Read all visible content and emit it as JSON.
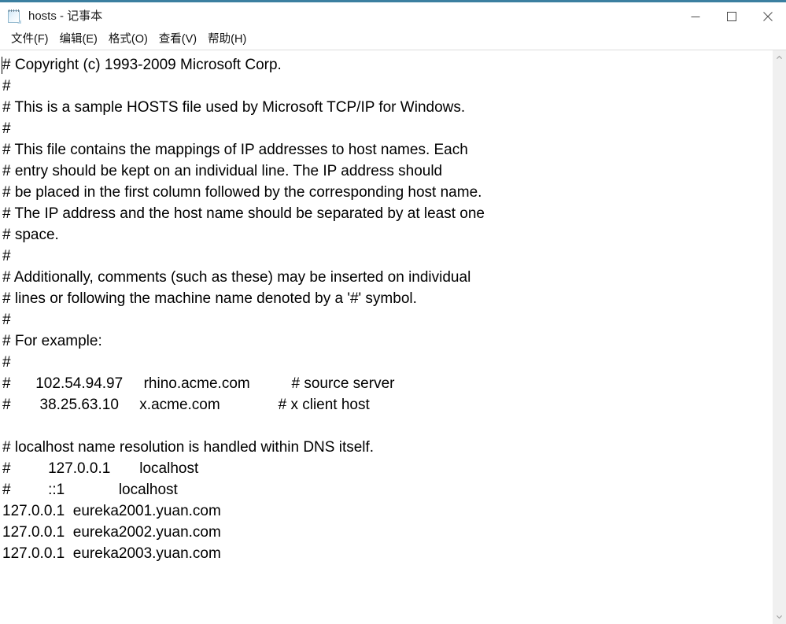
{
  "window": {
    "title": "hosts - 记事本",
    "icon": "notepad-icon",
    "accent_color": "#3b7fa0",
    "controls": {
      "minimize_label": "最小化",
      "maximize_label": "最大化",
      "close_label": "关闭"
    }
  },
  "menubar": {
    "items": [
      {
        "label": "文件(F)"
      },
      {
        "label": "编辑(E)"
      },
      {
        "label": "格式(O)"
      },
      {
        "label": "查看(V)"
      },
      {
        "label": "帮助(H)"
      }
    ]
  },
  "editor": {
    "caret_visible": true,
    "lines": [
      "# Copyright (c) 1993-2009 Microsoft Corp.",
      "#",
      "# This is a sample HOSTS file used by Microsoft TCP/IP for Windows.",
      "#",
      "# This file contains the mappings of IP addresses to host names. Each",
      "# entry should be kept on an individual line. The IP address should",
      "# be placed in the first column followed by the corresponding host name.",
      "# The IP address and the host name should be separated by at least one",
      "# space.",
      "#",
      "# Additionally, comments (such as these) may be inserted on individual",
      "# lines or following the machine name denoted by a '#' symbol.",
      "#",
      "# For example:",
      "#",
      "#      102.54.94.97     rhino.acme.com          # source server",
      "#       38.25.63.10     x.acme.com              # x client host",
      "",
      "# localhost name resolution is handled within DNS itself.",
      "#         127.0.0.1       localhost",
      "#         ::1             localhost",
      "127.0.0.1  eureka2001.yuan.com",
      "127.0.0.1  eureka2002.yuan.com",
      "127.0.0.1  eureka2003.yuan.com"
    ]
  },
  "scrollbar": {
    "up_arrow": "chevron-up-icon",
    "down_arrow": "chevron-down-icon"
  }
}
